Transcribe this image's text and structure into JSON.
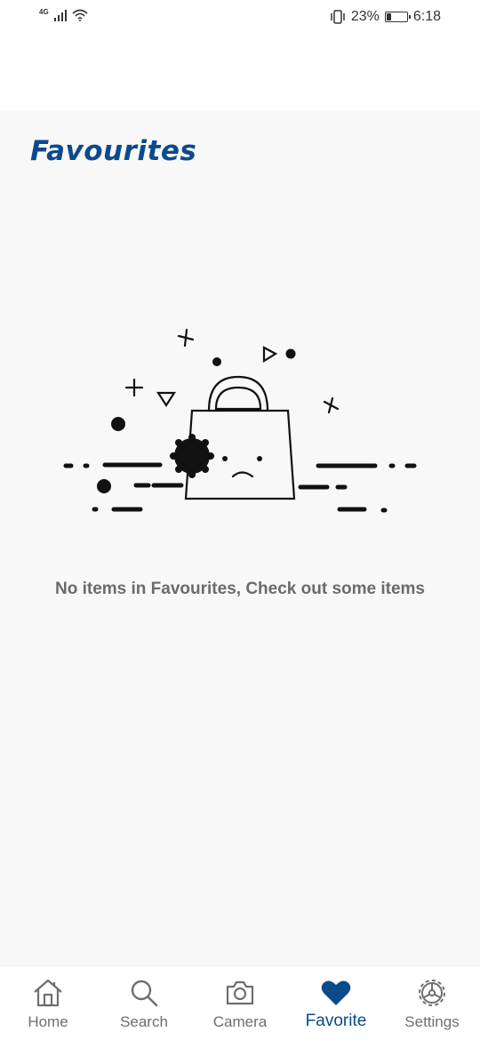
{
  "status_bar": {
    "network": "4G",
    "battery_percent": "23%",
    "battery_level": 0.23,
    "time": "6:18",
    "icons": [
      "signal-icon",
      "wifi-icon",
      "vibrate-icon",
      "battery-icon"
    ]
  },
  "page": {
    "title": "Favourites",
    "empty_message": "No items in Favourites, Check out some items"
  },
  "illustration": {
    "name": "sad-shopping-bag-illustration"
  },
  "bottom_nav": {
    "active_color": "#0b4a8c",
    "items": [
      {
        "label": "Home",
        "icon": "home-icon"
      },
      {
        "label": "Search",
        "icon": "search-icon"
      },
      {
        "label": "Camera",
        "icon": "camera-icon"
      },
      {
        "label": "Favorite",
        "icon": "heart-icon",
        "active": true
      },
      {
        "label": "Settings",
        "icon": "settings-icon"
      }
    ]
  }
}
